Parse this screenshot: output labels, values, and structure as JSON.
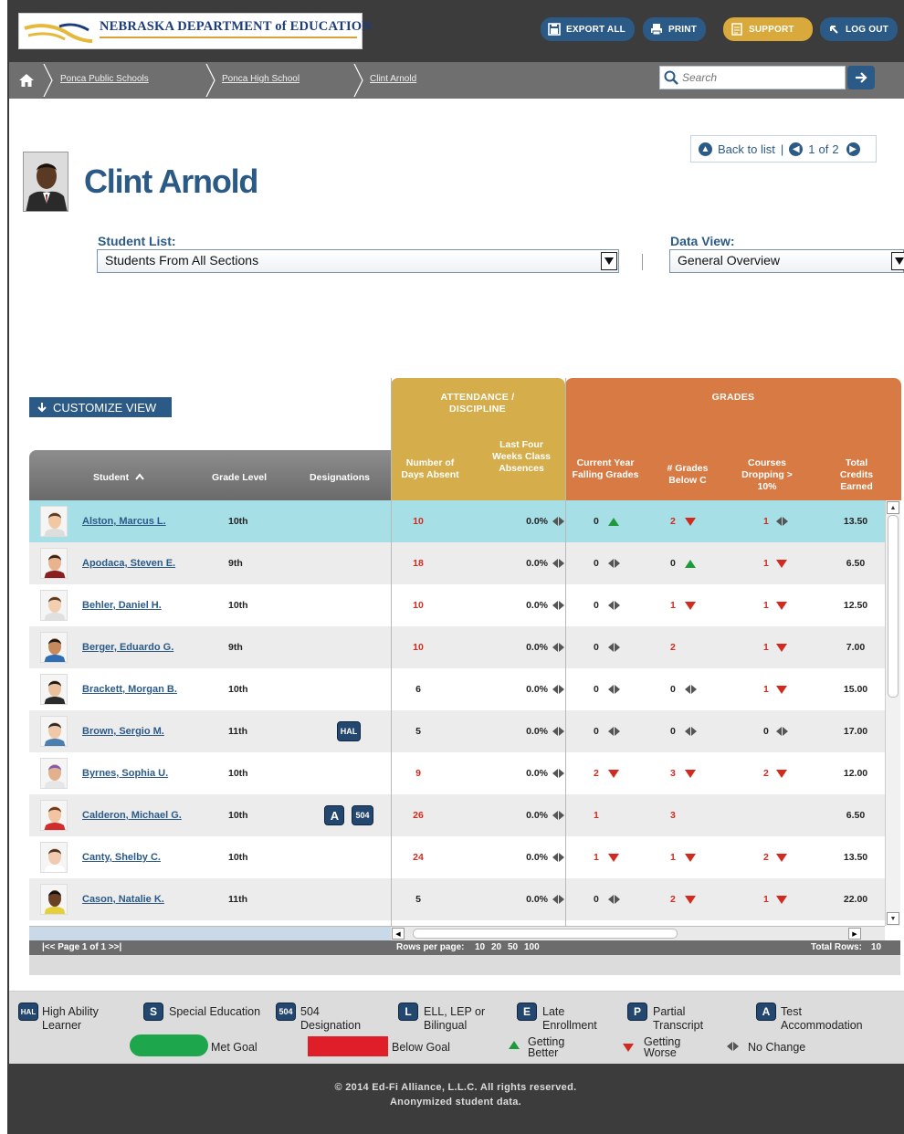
{
  "header": {
    "logo_text": "NEBRASKA DEPARTMENT of EDUCATION",
    "buttons": [
      {
        "label": "EXPORT ALL",
        "icon": "export-icon"
      },
      {
        "label": "PRINT",
        "icon": "printer-icon"
      },
      {
        "label": "SUPPORT",
        "icon": "document-icon"
      },
      {
        "label": "LOG OUT",
        "icon": "logout-arrow-icon"
      }
    ],
    "colors": {
      "brand_blue": "#2c5a86",
      "support_gold": "#d9a93b",
      "bar_dark": "#3c3c3c"
    }
  },
  "breadcrumb": {
    "items": [
      "Ponca Public Schools",
      "Ponca High School",
      "Clint Arnold"
    ]
  },
  "search": {
    "placeholder": "Search"
  },
  "student": {
    "name": "Clint Arnold",
    "nav": {
      "back_label": "Back to list",
      "position": "1",
      "of_label": "of",
      "total": "2"
    }
  },
  "filters": {
    "student_list_label": "Student List:",
    "student_list_value": "Students From All Sections",
    "data_view_label": "Data View:",
    "data_view_value": "General Overview"
  },
  "customize_label": "CUSTOMIZE VIEW",
  "grid": {
    "groups": {
      "attendance": "ATTENDANCE / DISCIPLINE",
      "grades": "GRADES"
    },
    "columns": {
      "student": "Student",
      "grade_level": "Grade Level",
      "designations": "Designations",
      "days_absent": "Number of Days Absent",
      "class_absences": "Last Four Weeks Class Absences",
      "failing_grades": "Current Year Falling Grades",
      "below_c": "# Grades Below C",
      "courses_dropping": "Courses Dropping > 10%",
      "credits": "Total Credits Earned"
    },
    "sort_column": "Student",
    "sort_direction": "ascending",
    "rows": [
      {
        "name": "Alston, Marcus L.",
        "grade": "10th",
        "designations": [],
        "absent": "10",
        "absent_red": true,
        "class_abs": "0.0%",
        "class_abs_trend": "none",
        "failing": "0",
        "failing_red": false,
        "failing_trend": "up",
        "below_c": "2",
        "below_c_red": true,
        "below_c_trend": "down",
        "dropping": "1",
        "dropping_red": true,
        "dropping_trend": "none",
        "credits": "13.50",
        "selected": true
      },
      {
        "name": "Apodaca, Steven E.",
        "grade": "9th",
        "designations": [],
        "absent": "18",
        "absent_red": true,
        "class_abs": "0.0%",
        "class_abs_trend": "none",
        "failing": "0",
        "failing_red": false,
        "failing_trend": "none",
        "below_c": "0",
        "below_c_red": false,
        "below_c_trend": "up",
        "dropping": "1",
        "dropping_red": true,
        "dropping_trend": "down",
        "credits": "6.50"
      },
      {
        "name": "Behler, Daniel H.",
        "grade": "10th",
        "designations": [],
        "absent": "10",
        "absent_red": true,
        "class_abs": "0.0%",
        "class_abs_trend": "none",
        "failing": "0",
        "failing_red": false,
        "failing_trend": "none",
        "below_c": "1",
        "below_c_red": true,
        "below_c_trend": "down",
        "dropping": "1",
        "dropping_red": true,
        "dropping_trend": "down",
        "credits": "12.50"
      },
      {
        "name": "Berger, Eduardo G.",
        "grade": "9th",
        "designations": [],
        "absent": "10",
        "absent_red": true,
        "class_abs": "0.0%",
        "class_abs_trend": "none",
        "failing": "0",
        "failing_red": false,
        "failing_trend": "none",
        "below_c": "2",
        "below_c_red": true,
        "below_c_trend": "",
        "dropping": "1",
        "dropping_red": true,
        "dropping_trend": "down",
        "credits": "7.00"
      },
      {
        "name": "Brackett, Morgan B.",
        "grade": "10th",
        "designations": [],
        "absent": "6",
        "absent_red": false,
        "class_abs": "0.0%",
        "class_abs_trend": "none",
        "failing": "0",
        "failing_red": false,
        "failing_trend": "none",
        "below_c": "0",
        "below_c_red": false,
        "below_c_trend": "none",
        "dropping": "1",
        "dropping_red": true,
        "dropping_trend": "down",
        "credits": "15.00"
      },
      {
        "name": "Brown, Sergio M.",
        "grade": "11th",
        "designations": [
          "HAL"
        ],
        "absent": "5",
        "absent_red": false,
        "class_abs": "0.0%",
        "class_abs_trend": "none",
        "failing": "0",
        "failing_red": false,
        "failing_trend": "none",
        "below_c": "0",
        "below_c_red": false,
        "below_c_trend": "none",
        "dropping": "0",
        "dropping_red": false,
        "dropping_trend": "none",
        "credits": "17.00"
      },
      {
        "name": "Byrnes, Sophia U.",
        "grade": "10th",
        "designations": [],
        "absent": "9",
        "absent_red": true,
        "class_abs": "0.0%",
        "class_abs_trend": "none",
        "failing": "2",
        "failing_red": true,
        "failing_trend": "down",
        "below_c": "3",
        "below_c_red": true,
        "below_c_trend": "down",
        "dropping": "2",
        "dropping_red": true,
        "dropping_trend": "down",
        "credits": "12.00"
      },
      {
        "name": "Calderon, Michael G.",
        "grade": "10th",
        "designations": [
          "A",
          "504"
        ],
        "absent": "26",
        "absent_red": true,
        "class_abs": "0.0%",
        "class_abs_trend": "none",
        "failing": "1",
        "failing_red": true,
        "failing_trend": "",
        "below_c": "3",
        "below_c_red": true,
        "below_c_trend": "",
        "dropping": "",
        "dropping_red": false,
        "dropping_trend": "",
        "credits": "6.50"
      },
      {
        "name": "Canty, Shelby C.",
        "grade": "10th",
        "designations": [],
        "absent": "24",
        "absent_red": true,
        "class_abs": "0.0%",
        "class_abs_trend": "none",
        "failing": "1",
        "failing_red": true,
        "failing_trend": "down",
        "below_c": "1",
        "below_c_red": true,
        "below_c_trend": "down",
        "dropping": "2",
        "dropping_red": true,
        "dropping_trend": "down",
        "credits": "13.50"
      },
      {
        "name": "Cason, Natalie K.",
        "grade": "11th",
        "designations": [],
        "absent": "5",
        "absent_red": false,
        "class_abs": "0.0%",
        "class_abs_trend": "none",
        "failing": "0",
        "failing_red": false,
        "failing_trend": "none",
        "below_c": "2",
        "below_c_red": true,
        "below_c_trend": "down",
        "dropping": "1",
        "dropping_red": true,
        "dropping_trend": "down",
        "credits": "22.00"
      }
    ],
    "pager": {
      "page_label": "|<< Page 1 of 1 >>|",
      "rows_per_page_label": "Rows per page:",
      "rows_per_page_options": [
        "10",
        "20",
        "50",
        "100"
      ],
      "total_rows_label": "Total Rows:",
      "total_rows": "10"
    },
    "colors": {
      "attendance": "#d6ad4b",
      "grades": "#d87a43",
      "selected_row": "#a7dfe7",
      "alarm_red": "#d22a1e",
      "good_green": "#1e9a3c"
    }
  },
  "legend": {
    "hal": {
      "badge": "HAL",
      "line1": "High Ability",
      "line2": "Learner"
    },
    "s": {
      "badge": "S",
      "line1": "Special Education",
      "line2": ""
    },
    "d504": {
      "badge": "504",
      "line1": "504",
      "line2": "Designation"
    },
    "l": {
      "badge": "L",
      "line1": "ELL, LEP or",
      "line2": "Bilingual"
    },
    "e": {
      "badge": "E",
      "line1": "Late",
      "line2": "Enrollment"
    },
    "p": {
      "badge": "P",
      "line1": "Partial",
      "line2": "Transcript"
    },
    "a": {
      "badge": "A",
      "line1": "Test",
      "line2": "Accommodation"
    },
    "met_goal": "Met Goal",
    "below_goal": "Below Goal",
    "getting_better": {
      "line1": "Getting",
      "line2": "Better"
    },
    "getting_worse": {
      "line1": "Getting",
      "line2": "Worse"
    },
    "no_change": "No Change"
  },
  "footer": {
    "copyright": "© 2014 Ed-Fi Alliance, L.L.C. All rights reserved.",
    "note": "Anonymized student data."
  }
}
